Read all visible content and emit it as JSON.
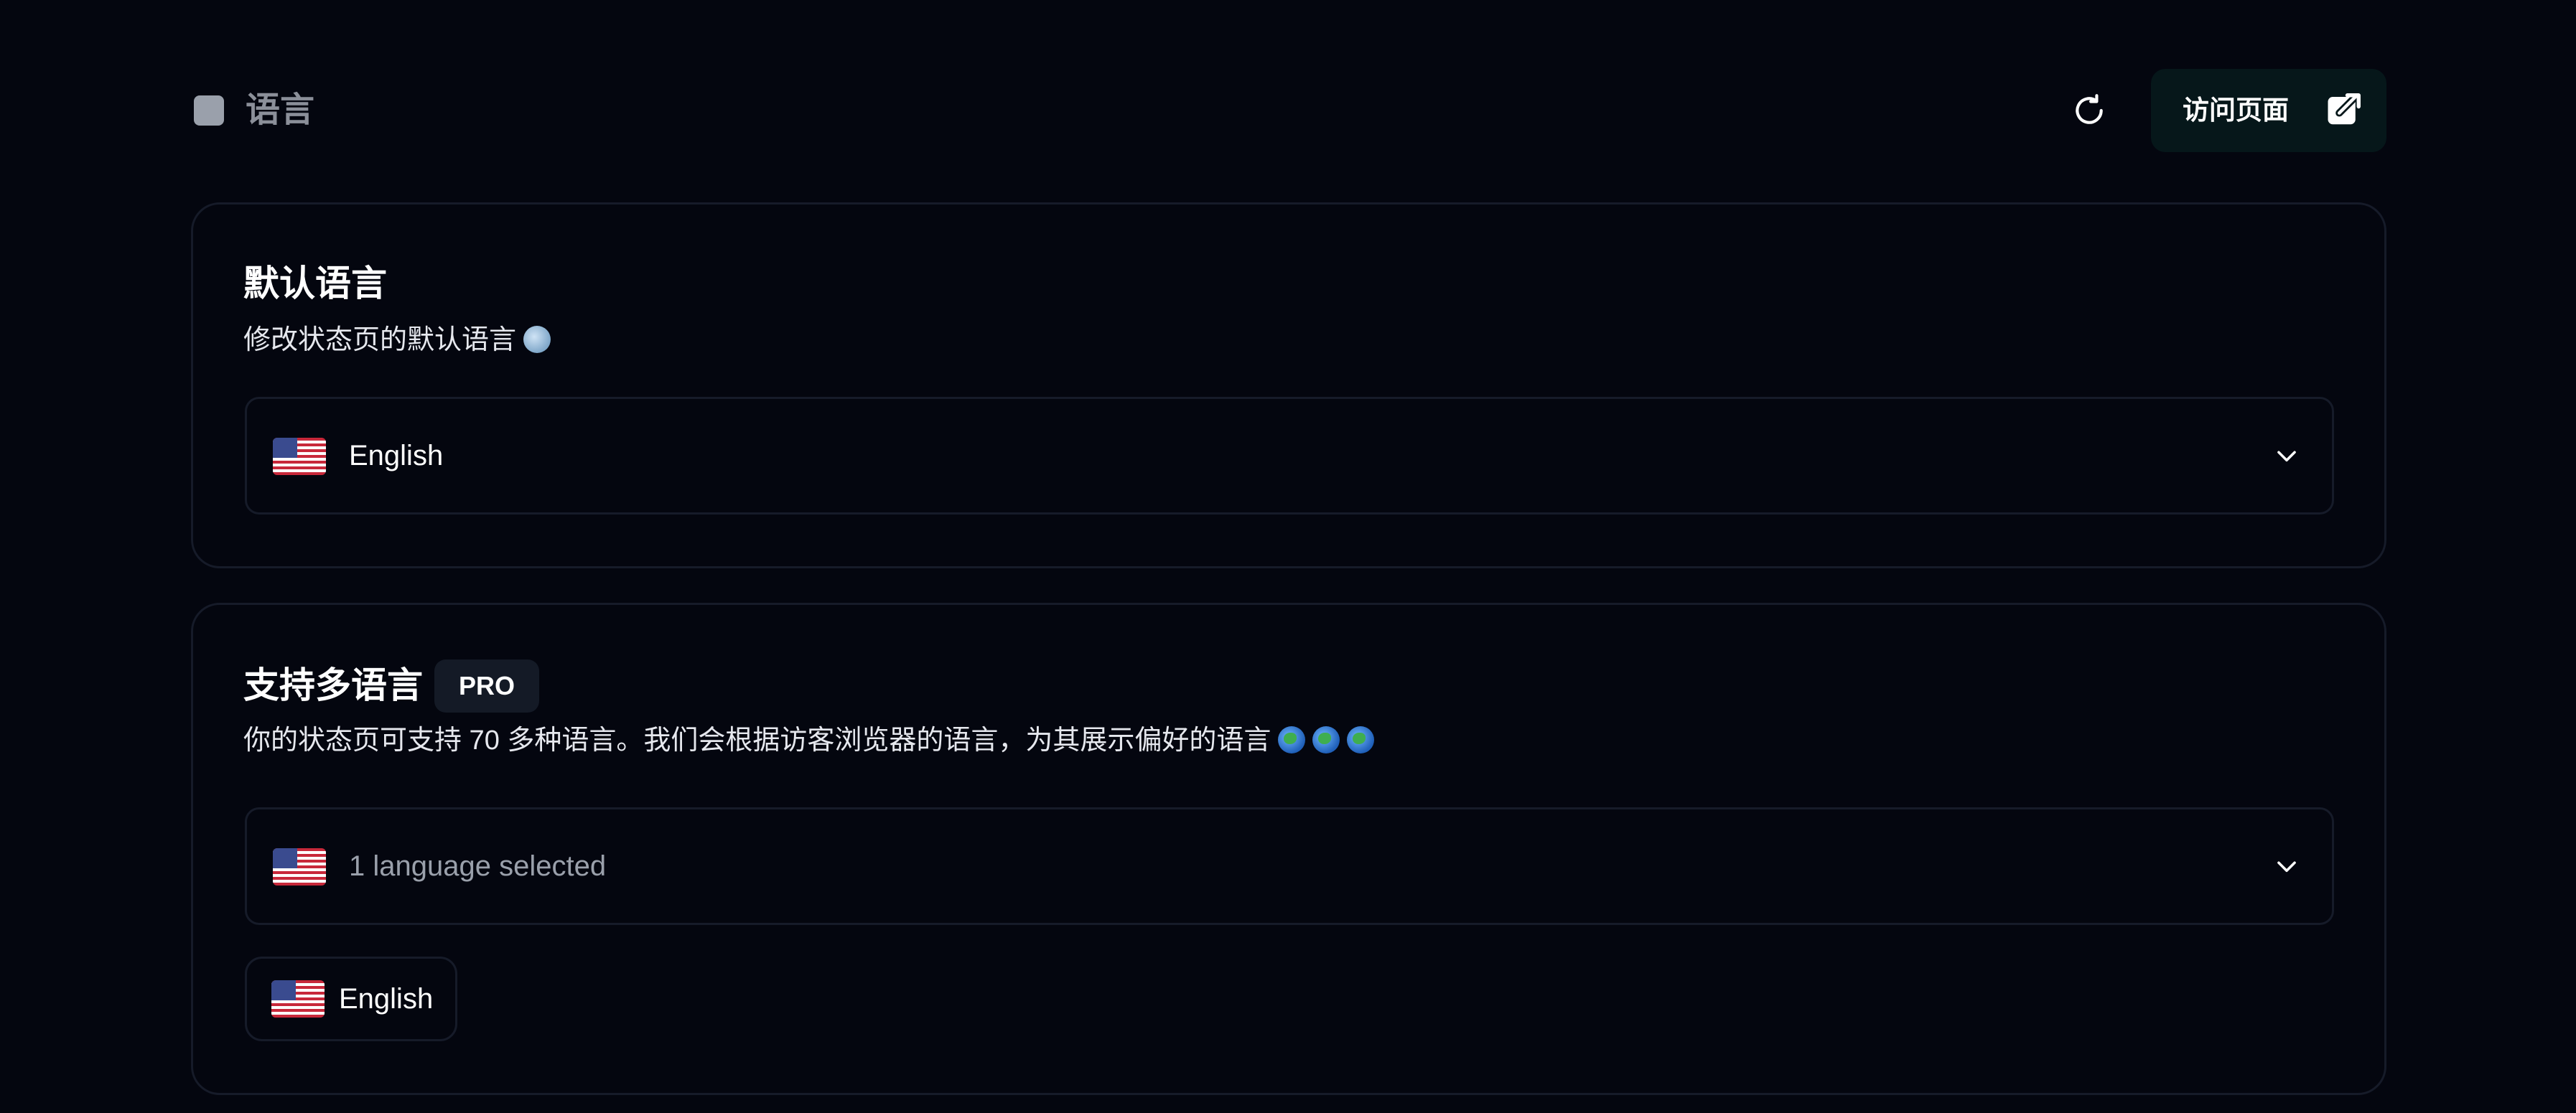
{
  "header": {
    "title": "语言",
    "visit_label": "访问页面"
  },
  "default_language": {
    "title": "默认语言",
    "description": "修改状态页的默认语言",
    "selected_value": "English",
    "flag": "us-flag-icon"
  },
  "multi_language": {
    "title": "支持多语言",
    "badge": "PRO",
    "description": "你的状态页可支持 70 多种语言。我们会根据访客浏览器的语言，为其展示偏好的语言",
    "select_placeholder": "1 language selected",
    "chips": [
      {
        "label": "English",
        "flag": "us-flag-icon"
      }
    ]
  },
  "colors": {
    "background": "#04060f",
    "border": "#161b29",
    "button_bg": "#06171a",
    "badge_bg": "#141a26",
    "muted_text": "#9aa0ab"
  },
  "icons": [
    "refresh-icon",
    "external-link-icon",
    "chevron-down-icon",
    "globe-icon",
    "earth-icon",
    "us-flag-icon"
  ]
}
